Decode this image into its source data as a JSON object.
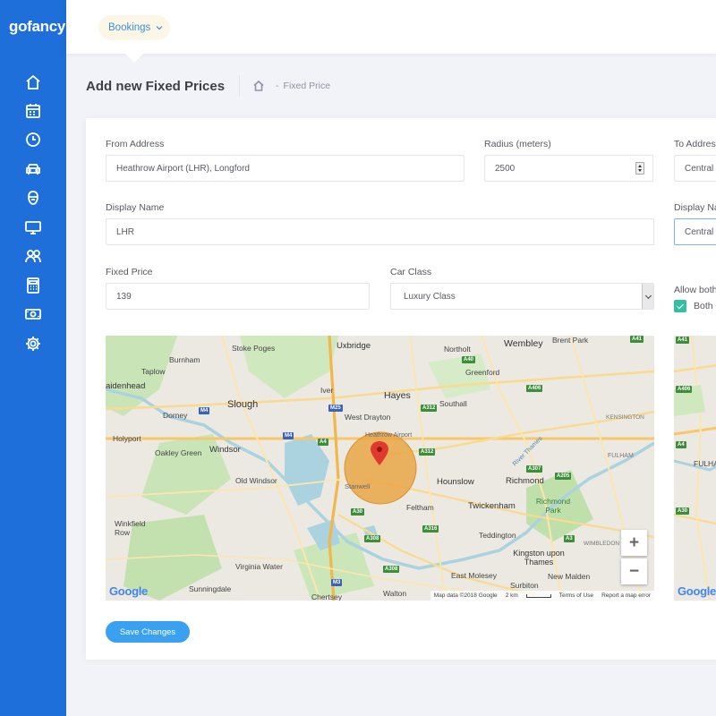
{
  "app": {
    "logo": "gofancy"
  },
  "colors": {
    "sidebar": "#1e6fd9",
    "accent": "#3aa0f0",
    "checkbox": "#34bfa3",
    "radius_circle": "#e8a33d"
  },
  "sidebar": {
    "items": [
      {
        "icon": "home-icon"
      },
      {
        "icon": "calendar-icon"
      },
      {
        "icon": "clock-icon"
      },
      {
        "icon": "car-icon"
      },
      {
        "icon": "driver-icon"
      },
      {
        "icon": "monitor-icon"
      },
      {
        "icon": "users-icon"
      },
      {
        "icon": "calculator-icon"
      },
      {
        "icon": "money-icon"
      },
      {
        "icon": "gear-icon"
      }
    ]
  },
  "topbar": {
    "menu_label": "Bookings"
  },
  "subheader": {
    "title": "Add new Fixed Prices",
    "breadcrumb": "Fixed Price",
    "breadcrumb_sep": "-"
  },
  "form": {
    "from_address": {
      "label": "From Address",
      "value": "Heathrow Airport (LHR), Longford"
    },
    "radius": {
      "label": "Radius (meters)",
      "value": "2500"
    },
    "to_address": {
      "label": "To Address",
      "value": "Central L"
    },
    "display_name": {
      "label": "Display Name",
      "value": "LHR"
    },
    "display_name_to": {
      "label": "Display Na",
      "value": "Central L"
    },
    "fixed_price": {
      "label": "Fixed Price",
      "value": "139"
    },
    "car_class": {
      "label": "Car Class",
      "value": "Luxury Class"
    },
    "allow_both": {
      "label": "Allow both",
      "checkbox_label": "Both",
      "checked": true
    },
    "save_label": "Save Changes"
  },
  "map": {
    "towns": [
      "Uxbridge",
      "Northolt",
      "Wembley",
      "Brent Park",
      "Stoke Poges",
      "Burnham",
      "Taplow",
      "Greenford",
      "aidenhead",
      "Iver",
      "Hayes",
      "Slough",
      "Southall",
      "Dorney",
      "West Drayton",
      "Heathrow Airport",
      "Holyport",
      "Windsor",
      "Oakley Green",
      "Old Windsor",
      "Stanwell",
      "Hounslow",
      "Richmond",
      "Richmond Park",
      "Feltham",
      "Twickenham",
      "Winkfield Row",
      "Teddington",
      "Virginia Water",
      "Kingston upon Thames",
      "East Molesey",
      "New Malden",
      "Sunningdale",
      "Surbiton",
      "Chertsey",
      "Walton",
      "KENSINGTON",
      "FULHAM",
      "WIMBLEDON",
      "River Thames"
    ],
    "roads": [
      "A41",
      "A406",
      "A40",
      "A312",
      "M25",
      "M4",
      "A4",
      "A30",
      "A316",
      "A308",
      "A307",
      "A205",
      "A3",
      "M3"
    ],
    "footer": {
      "data": "Map data ©2018 Google",
      "scale": "2 km",
      "terms": "Terms of Use",
      "report": "Report a map error"
    },
    "google": "Google",
    "zoom_in": "+",
    "zoom_out": "−"
  }
}
